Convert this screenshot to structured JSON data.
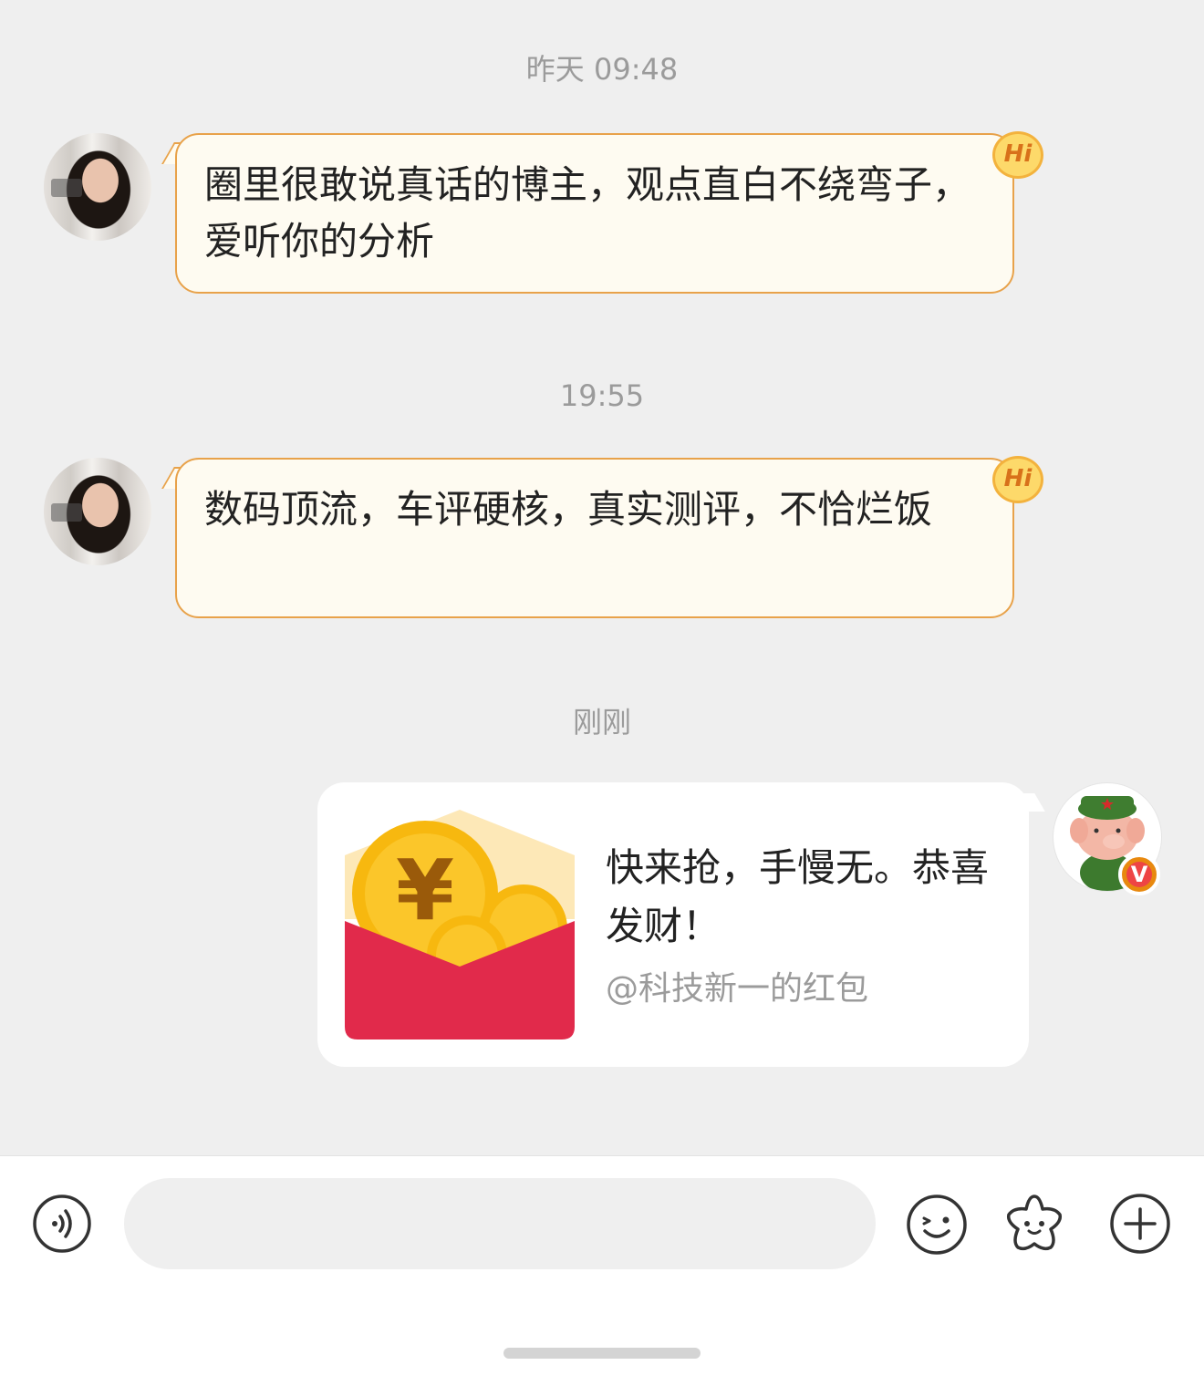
{
  "messages": [
    {
      "timestamp": "昨天 09:48",
      "text": "圈里很敢说真话的博主，观点直白不绕弯子，爱听你的分析",
      "badge": "Hi"
    },
    {
      "timestamp": "19:55",
      "text": "数码顶流，车评硬核，真实测评，不恰烂饭",
      "badge": "Hi"
    }
  ],
  "red_packet": {
    "timestamp": "刚刚",
    "title": "快来抢，手慢无。恭喜发财！",
    "from": "@科技新一的红包",
    "currency_symbol": "¥",
    "colors": {
      "envelope": "#e12a4b",
      "coin": "#f7b80f",
      "flap": "#fde8b7"
    }
  },
  "verified_badge": "V",
  "input": {
    "placeholder": ""
  },
  "icons": [
    "voice-icon",
    "emoji-icon",
    "sticker-icon",
    "add-icon"
  ],
  "colors": {
    "bubble_border": "#e8a24a",
    "bubble_bg": "#fefbf1",
    "background": "#efefef"
  }
}
